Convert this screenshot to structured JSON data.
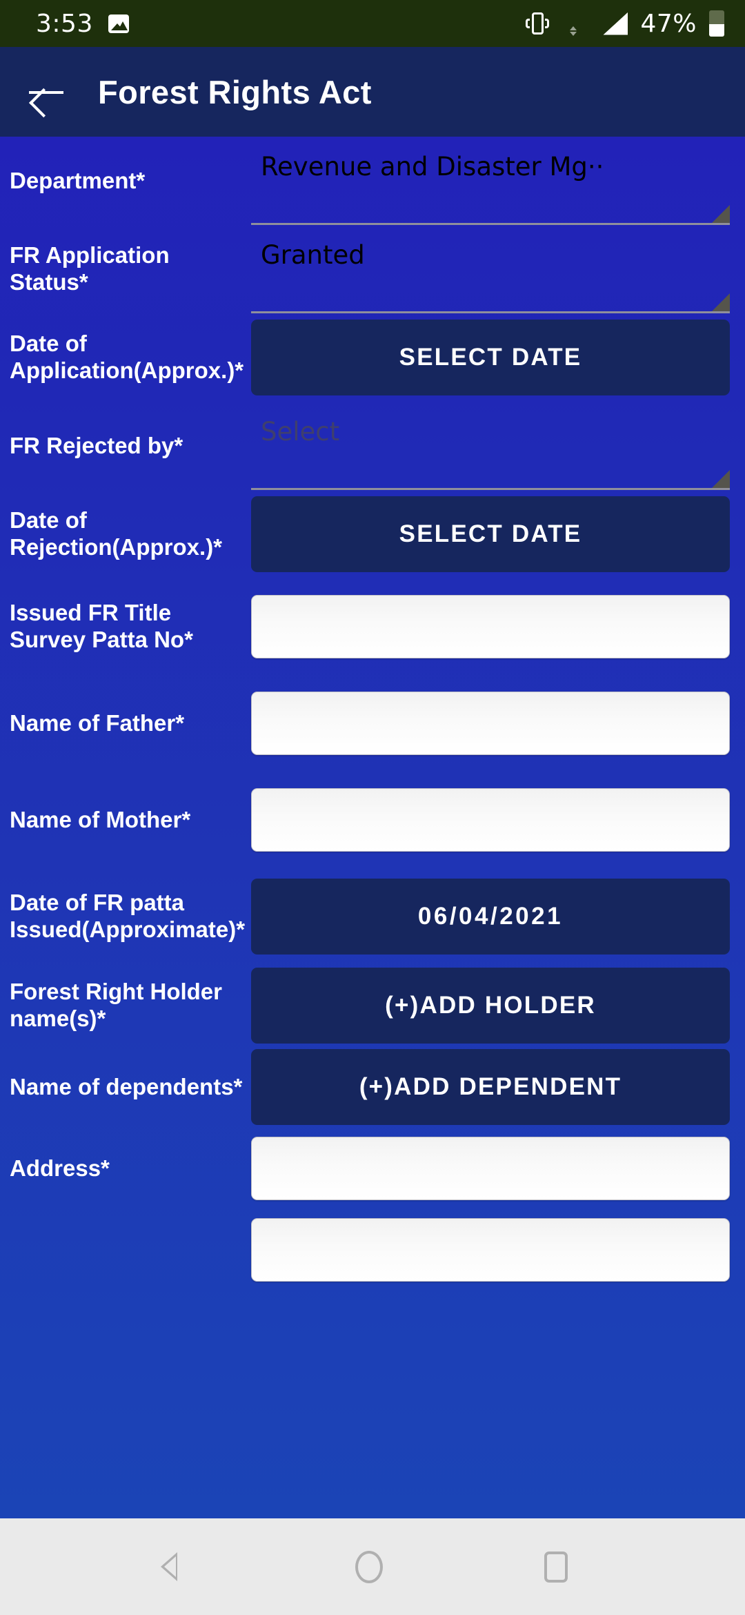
{
  "status_bar": {
    "time": "3:53",
    "battery_percent": "47%",
    "icons": [
      "photo-icon",
      "vibrate-icon",
      "wifi-icon",
      "signal-icon",
      "battery-icon"
    ]
  },
  "toolbar": {
    "back_icon": "back-arrow-icon",
    "title": "Forest Rights Act"
  },
  "form": {
    "rows": [
      {
        "label": "Department*",
        "type": "spinner",
        "value": "Revenue and Disaster Mg··",
        "placeholder": false
      },
      {
        "label": "FR Application Status*",
        "type": "spinner",
        "value": "Granted",
        "placeholder": false
      },
      {
        "label": "Date of Application(Approx.)*",
        "type": "button",
        "value": "SELECT DATE"
      },
      {
        "label": "FR Rejected by*",
        "type": "spinner",
        "value": "Select",
        "placeholder": true
      },
      {
        "label": "Date of Rejection(Approx.)*",
        "type": "button",
        "value": "SELECT DATE"
      },
      {
        "label": "Issued FR Title Survey Patta No*",
        "type": "text",
        "value": "",
        "placeholder": ""
      },
      {
        "label": "Name of Father*",
        "type": "text",
        "value": "",
        "placeholder": ""
      },
      {
        "label": "Name of Mother*",
        "type": "text",
        "value": "",
        "placeholder": ""
      },
      {
        "label": "Date of FR patta Issued(Approximate)*",
        "type": "button-date",
        "value": "06/04/2021"
      },
      {
        "label": "Forest Right Holder name(s)*",
        "type": "button",
        "value": "(+)ADD HOLDER"
      },
      {
        "label": "Name of dependents*",
        "type": "button",
        "value": "(+)ADD DEPENDENT"
      },
      {
        "label": "Address*",
        "type": "text",
        "value": "",
        "placeholder": ""
      },
      {
        "label": "",
        "type": "text",
        "value": "",
        "placeholder": ""
      }
    ]
  },
  "nav_bar": {
    "back": "back-triangle-icon",
    "home": "home-circle-icon",
    "recents": "recents-square-icon"
  },
  "colors": {
    "status_bar_bg": "#1e300c",
    "toolbar_bg": "#16265e",
    "form_bg": "#1f35b5",
    "button_bg": "#16265e",
    "nav_bar_bg": "#eaeaea"
  }
}
